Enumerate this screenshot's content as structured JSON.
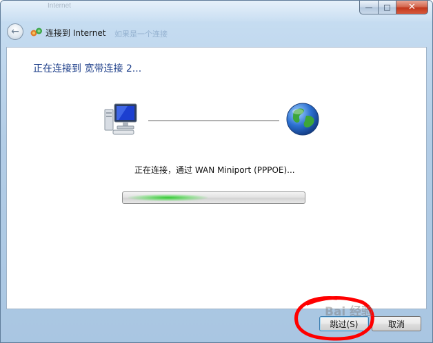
{
  "window": {
    "ghost_title": "Internet",
    "ghost_link": "如果是一个连接",
    "caption": {
      "minimize": "—",
      "maximize": "□",
      "close": "✕"
    }
  },
  "nav": {
    "title": "连接到 Internet",
    "back_icon": "back-arrow-icon",
    "network_icon": "network-connection-icon"
  },
  "content": {
    "heading": "正在连接到 宽带连接 2...",
    "status": "正在连接，通过 WAN Miniport (PPPOE)...",
    "computer_icon": "computer-icon",
    "globe_icon": "globe-icon"
  },
  "buttons": {
    "skip": "跳过(S)",
    "cancel": "取消"
  },
  "watermark": "Bai 经验",
  "colors": {
    "heading": "#1e3f8a",
    "progress": "#28c828",
    "annotation": "#ff0000"
  }
}
